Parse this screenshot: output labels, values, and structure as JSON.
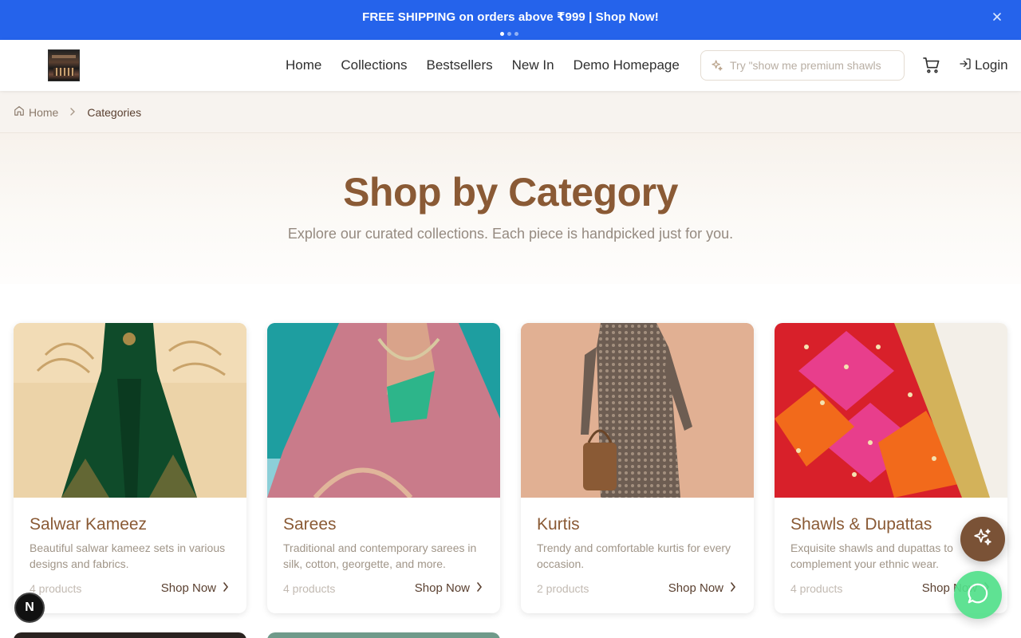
{
  "promo": {
    "text": "FREE SHIPPING on orders above ₹999 | Shop Now!",
    "close_icon": "close-icon",
    "dots": 3,
    "active_dot": 0,
    "background": "#2563eb"
  },
  "header": {
    "nav": [
      {
        "label": "Home"
      },
      {
        "label": "Collections"
      },
      {
        "label": "Bestsellers"
      },
      {
        "label": "New In"
      },
      {
        "label": "Demo Homepage"
      }
    ],
    "search": {
      "placeholder": "Try \"show me premium shawls",
      "icon": "sparkle-icon"
    },
    "cart_icon": "cart-icon",
    "login_label": "Login",
    "login_icon": "login-icon"
  },
  "breadcrumb": {
    "home": "Home",
    "current": "Categories"
  },
  "hero": {
    "title": "Shop by Category",
    "subtitle": "Explore our curated collections. Each piece is handpicked just for you."
  },
  "categories": [
    {
      "name": "Salwar Kameez",
      "description": "Beautiful salwar kameez sets in various designs and fabrics.",
      "count": "4 products",
      "cta": "Shop Now"
    },
    {
      "name": "Sarees",
      "description": "Traditional and contemporary sarees in silk, cotton, georgette, and more.",
      "count": "4 products",
      "cta": "Shop Now"
    },
    {
      "name": "Kurtis",
      "description": "Trendy and comfortable kurtis for every occasion.",
      "count": "2 products",
      "cta": "Shop Now"
    },
    {
      "name": "Shawls & Dupattas",
      "description": "Exquisite shawls and dupattas to complement your ethnic wear.",
      "count": "4 products",
      "cta": "Shop Now"
    }
  ],
  "floating": {
    "ai_icon": "sparkle-icon",
    "chat_icon": "chat-icon",
    "dev_badge": "N"
  },
  "colors": {
    "brand_brown": "#8a5a35",
    "accent_green": "#52e08a"
  }
}
